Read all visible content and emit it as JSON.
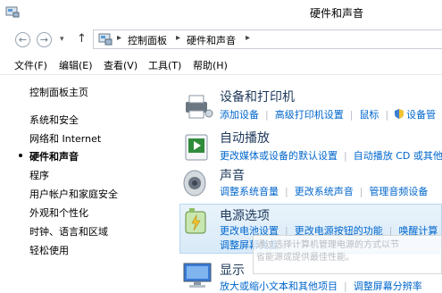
{
  "window": {
    "title": "硬件和声音"
  },
  "nav": {
    "back_icon": "←",
    "forward_icon": "→",
    "recent_icon": "▾",
    "up_icon": "↑"
  },
  "address": {
    "crumbs": [
      "控制面板",
      "硬件和声音"
    ],
    "separator": "▸"
  },
  "menu": [
    "文件(F)",
    "编辑(E)",
    "查看(V)",
    "工具(T)",
    "帮助(H)"
  ],
  "sidebar": {
    "home": "控制面板主页",
    "items": [
      "系统和安全",
      "网络和 Internet",
      "硬件和声音",
      "程序",
      "用户帐户和家庭安全",
      "外观和个性化",
      "时钟、语言和区域",
      "轻松使用"
    ],
    "current_index": 2
  },
  "categories": [
    {
      "title": "设备和打印机",
      "links": [
        [
          "添加设备",
          "高级打印机设置",
          "鼠标",
          "设备管"
        ]
      ]
    },
    {
      "title": "自动播放",
      "links": [
        [
          "更改媒体或设备的默认设置",
          "自动播放 CD 或其他"
        ]
      ]
    },
    {
      "title": "声音",
      "links": [
        [
          "调整系统音量",
          "更改系统声音",
          "管理音频设备"
        ]
      ]
    },
    {
      "title": "电源选项",
      "links": [
        [
          "更改电池设置",
          "更改电源按钮的功能",
          "唤醒计算"
        ],
        [
          "调整屏幕亮度"
        ]
      ]
    },
    {
      "title": "显示",
      "links": [
        [
          "放大或缩小文本和其他项目",
          "调整屏幕分辨率"
        ]
      ]
    }
  ],
  "tooltip": {
    "line1": "通过选择计算机管理电源的方式以节",
    "line2": "省能源或提供最佳性能。"
  },
  "colors": {
    "link": "#0066cc",
    "category_title": "#1e395b",
    "hover_bg": "#dcecf9"
  }
}
